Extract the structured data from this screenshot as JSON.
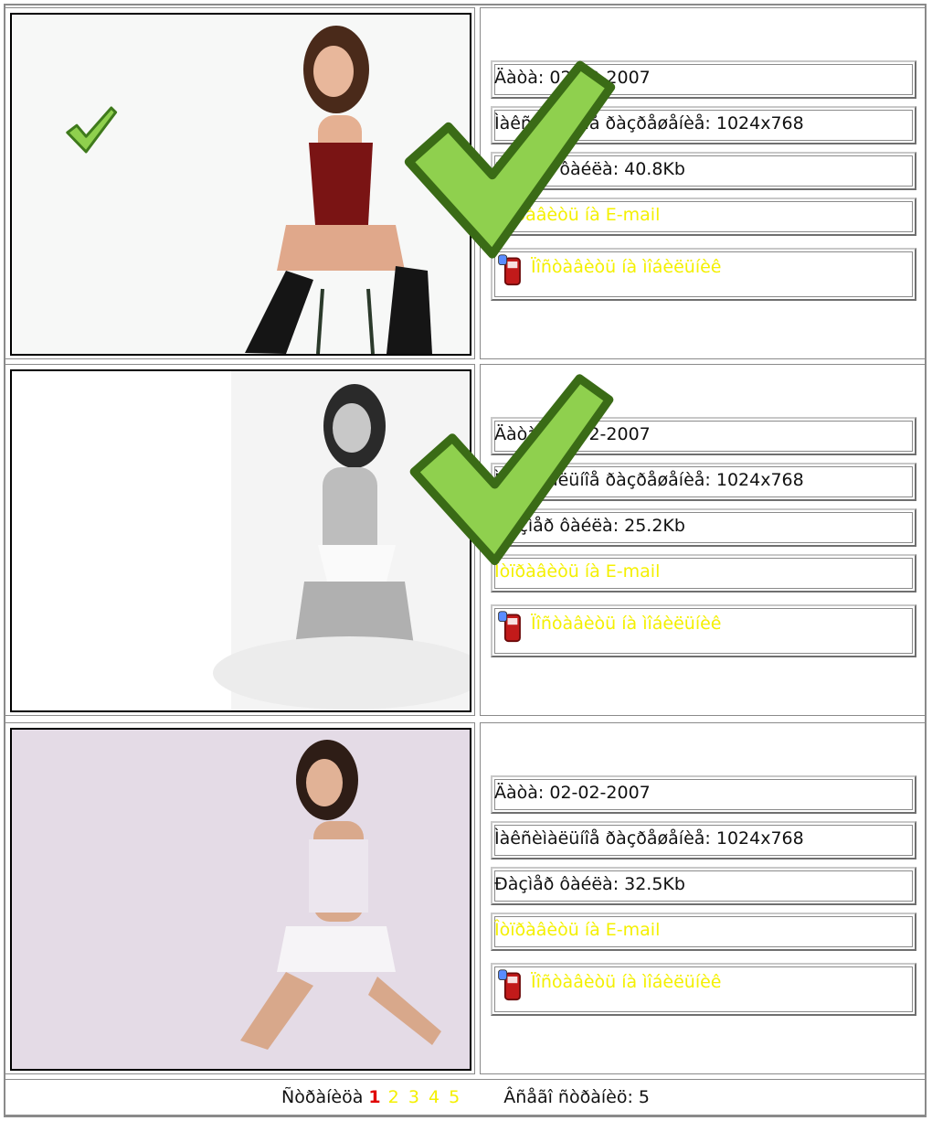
{
  "rows": [
    {
      "date": "Äàòà: 02-02-2007",
      "resolution": "Ìàêñèìàëüíîå ðàçðåøåíèå: 1024x768",
      "size": "Ðàçìåð ôàéëà: 40.8Kb",
      "email_link": "Îòïðàâèòü íà E-mail",
      "mobile_link": "Ïîñòàâèòü íà ìîáèëüíèê"
    },
    {
      "date": "Äàòà: 02-02-2007",
      "resolution": "Ìàêñèìàëüíîå ðàçðåøåíèå: 1024x768",
      "size": "Ðàçìåð ôàéëà: 25.2Kb",
      "email_link": "Îòïðàâèòü íà E-mail",
      "mobile_link": "Ïîñòàâèòü íà ìîáèëüíèê"
    },
    {
      "date": "Äàòà: 02-02-2007",
      "resolution": "Ìàêñèìàëüíîå ðàçðåøåíèå: 1024x768",
      "size": "Ðàçìåð ôàéëà: 32.5Kb",
      "email_link": "Îòïðàâèòü íà E-mail",
      "mobile_link": "Ïîñòàâèòü íà ìîáèëüíèê"
    }
  ],
  "pager": {
    "label": "Ñòðàíèöà",
    "current": "1",
    "pages": [
      "2",
      "3",
      "4",
      "5"
    ],
    "total_label": "Âñåãî ñòðàíèö: 5"
  },
  "colors": {
    "link": "#f4f000",
    "current_page": "#e00000",
    "check_green": "#5c9e2a"
  },
  "icons": [
    "checkmark-icon",
    "mobile-phone-icon"
  ]
}
